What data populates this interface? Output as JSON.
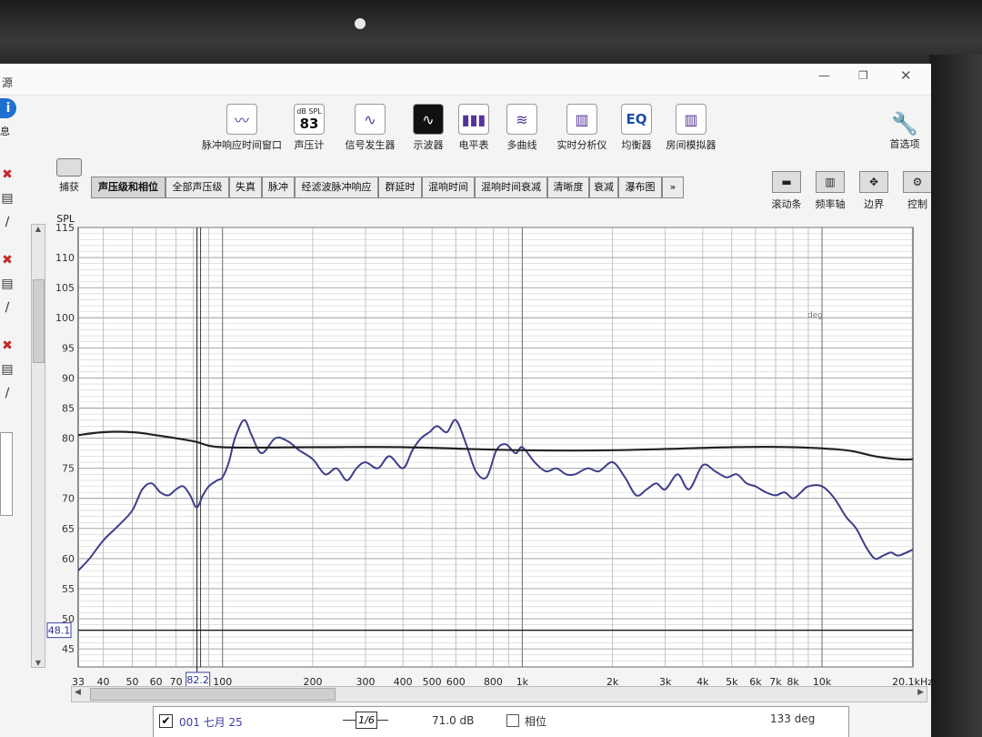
{
  "window": {
    "title_glyph": "源"
  },
  "toolbar": {
    "items": [
      {
        "id": "impulse",
        "label": "脉冲响应时间窗口",
        "icon": "impulse-window-icon"
      },
      {
        "id": "splmeter",
        "label": "声压计",
        "icon": "spl-meter-icon",
        "badge_top": "dB SPL",
        "badge_value": "83"
      },
      {
        "id": "generator",
        "label": "信号发生器",
        "icon": "sine-wave-icon"
      },
      {
        "id": "scope",
        "label": "示波器",
        "icon": "oscilloscope-icon"
      },
      {
        "id": "levels",
        "label": "电平表",
        "icon": "level-meter-icon"
      },
      {
        "id": "overlays",
        "label": "多曲线",
        "icon": "overlay-curves-icon"
      },
      {
        "id": "rta",
        "label": "实时分析仪",
        "icon": "rta-icon"
      },
      {
        "id": "eq",
        "label": "均衡器",
        "icon": "eq-icon",
        "badge_value": "EQ"
      },
      {
        "id": "room",
        "label": "房间模拟器",
        "icon": "room-sim-icon"
      }
    ],
    "prefs_label": "首选项",
    "capture_label": "捕获"
  },
  "tabs": [
    "声压级和相位",
    "全部声压级",
    "失真",
    "脉冲",
    "经滤波脉冲响应",
    "群延时",
    "混响时间",
    "混响时间衰减",
    "清晰度",
    "衰减",
    "瀑布图",
    "»"
  ],
  "right_tools": [
    {
      "label": "滚动条",
      "icon": "scrollbar-icon"
    },
    {
      "label": "频率轴",
      "icon": "freq-axis-icon"
    },
    {
      "label": "边界",
      "icon": "limits-icon"
    },
    {
      "label": "控制",
      "icon": "gear-icon"
    }
  ],
  "left_panel": {
    "info_label": "息"
  },
  "graph": {
    "y_axis_label": "SPL",
    "y_ticks": [
      "115",
      "110",
      "105",
      "100",
      "95",
      "90",
      "85",
      "80",
      "75",
      "70",
      "65",
      "60",
      "55",
      "50",
      "45"
    ],
    "x_ticks": [
      "33",
      "40",
      "50",
      "60",
      "70",
      "100",
      "200",
      "300",
      "400",
      "500",
      "600",
      "800",
      "1k",
      "2k",
      "3k",
      "4k",
      "5k",
      "6k",
      "7k",
      "8k",
      "10k",
      "20.1kHz"
    ],
    "cursor_x_label": "82.2",
    "cursor_y_label": "48.1",
    "phase_axis_label": "deg"
  },
  "legend": {
    "checked": true,
    "name": "001 七月 25",
    "smoothing": "1/6",
    "level": "71.0 dB",
    "phase_label": "相位",
    "phase_value": "133 deg"
  },
  "chart_data": {
    "type": "line",
    "xscale": "log",
    "xlim": [
      33,
      20100
    ],
    "ylim": [
      42,
      115
    ],
    "series": [
      {
        "color": "#3d3f8a",
        "x": [
          33,
          36,
          40,
          45,
          50,
          54,
          58,
          62,
          66,
          70,
          74,
          78,
          82,
          86,
          90,
          96,
          100,
          105,
          110,
          118,
          125,
          135,
          150,
          165,
          180,
          200,
          220,
          240,
          260,
          280,
          300,
          330,
          360,
          400,
          430,
          460,
          490,
          520,
          560,
          600,
          650,
          700,
          760,
          820,
          880,
          950,
          1000,
          1100,
          1200,
          1300,
          1400,
          1500,
          1650,
          1800,
          2000,
          2200,
          2400,
          2600,
          2800,
          3000,
          3300,
          3600,
          4000,
          4400,
          4800,
          5200,
          5600,
          6000,
          6500,
          7000,
          7500,
          8000,
          8500,
          9000,
          10000,
          11000,
          12000,
          13000,
          14000,
          15000,
          16000,
          17000,
          18000,
          20100
        ],
        "y": [
          58,
          60,
          63,
          65.5,
          68,
          71.5,
          72.5,
          71,
          70.5,
          71.5,
          72,
          70.5,
          68.5,
          70.5,
          72,
          73,
          73.5,
          76,
          80,
          83,
          80.5,
          77.5,
          80,
          79.5,
          78,
          76.5,
          74,
          75,
          73,
          75,
          76,
          75,
          77,
          75,
          78,
          80,
          81,
          82,
          81,
          83,
          79,
          74.5,
          73.5,
          78,
          79,
          77.5,
          78.5,
          76,
          74.5,
          75,
          74,
          74,
          75,
          74.5,
          76,
          73.5,
          70.5,
          71.5,
          72.5,
          71.5,
          74,
          71.5,
          75.5,
          74.5,
          73.5,
          74,
          72.5,
          72,
          71,
          70.5,
          71,
          70,
          71,
          72,
          72,
          70,
          67,
          65,
          62,
          60,
          60.5,
          61,
          60.5,
          61.5
        ]
      },
      {
        "color": "#222222",
        "x": [
          33,
          40,
          50,
          60,
          80,
          100,
          200,
          400,
          1000,
          2000,
          5000,
          8000,
          12000,
          15000,
          18000,
          20100
        ],
        "y": [
          80.5,
          81,
          81,
          80.5,
          79.5,
          78.5,
          78.5,
          78.5,
          78,
          78,
          78.5,
          78.5,
          78,
          77,
          76.5,
          76.5
        ]
      }
    ]
  }
}
